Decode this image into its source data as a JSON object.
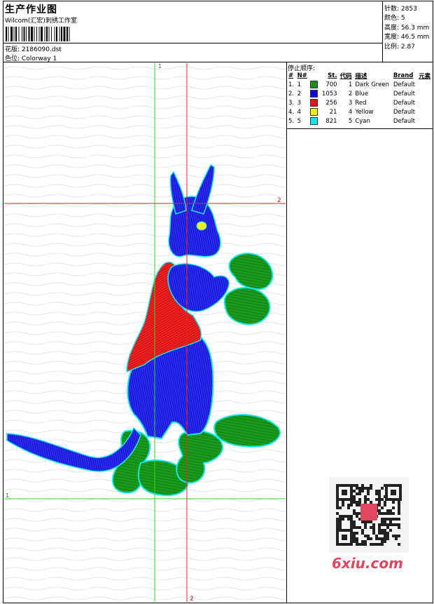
{
  "header": {
    "title": "生产作业图",
    "company": "Wilcom(汇宏)刺绣工作室",
    "design_label": "花版:",
    "design_value": "2186090.dst",
    "colorway_label": "色位:",
    "colorway_value": "Colorway 1"
  },
  "stats": {
    "stitches": "针数: 2853",
    "colors": "颜色: 5",
    "height": "高度: 56.3 mm",
    "width": "宽度: 46.5 mm",
    "scale": "比例: 2.87"
  },
  "sequence": {
    "title": "停止顺序:",
    "columns": [
      "#",
      "N#",
      "St.",
      "代码",
      "描述",
      "Brand",
      "元素"
    ],
    "rows": [
      {
        "idx": "1.",
        "n": "1",
        "color": "#1a8c1a",
        "st": "700",
        "code": "1",
        "desc": "Dark Green",
        "brand": "Default"
      },
      {
        "idx": "2.",
        "n": "2",
        "color": "#0a0ae6",
        "st": "1053",
        "code": "2",
        "desc": "Blue",
        "brand": "Default"
      },
      {
        "idx": "3.",
        "n": "3",
        "color": "#e61414",
        "st": "256",
        "code": "3",
        "desc": "Red",
        "brand": "Default"
      },
      {
        "idx": "4.",
        "n": "4",
        "color": "#f2f20a",
        "st": "21",
        "code": "4",
        "desc": "Yellow",
        "brand": "Default"
      },
      {
        "idx": "5.",
        "n": "5",
        "color": "#18e6e6",
        "st": "821",
        "code": "5",
        "desc": "Cyan",
        "brand": "Default"
      }
    ]
  },
  "guides": {
    "green_v": "1",
    "red_h": "2",
    "green_h": "1",
    "red_v": "2"
  },
  "watermark": "6xiu.com"
}
